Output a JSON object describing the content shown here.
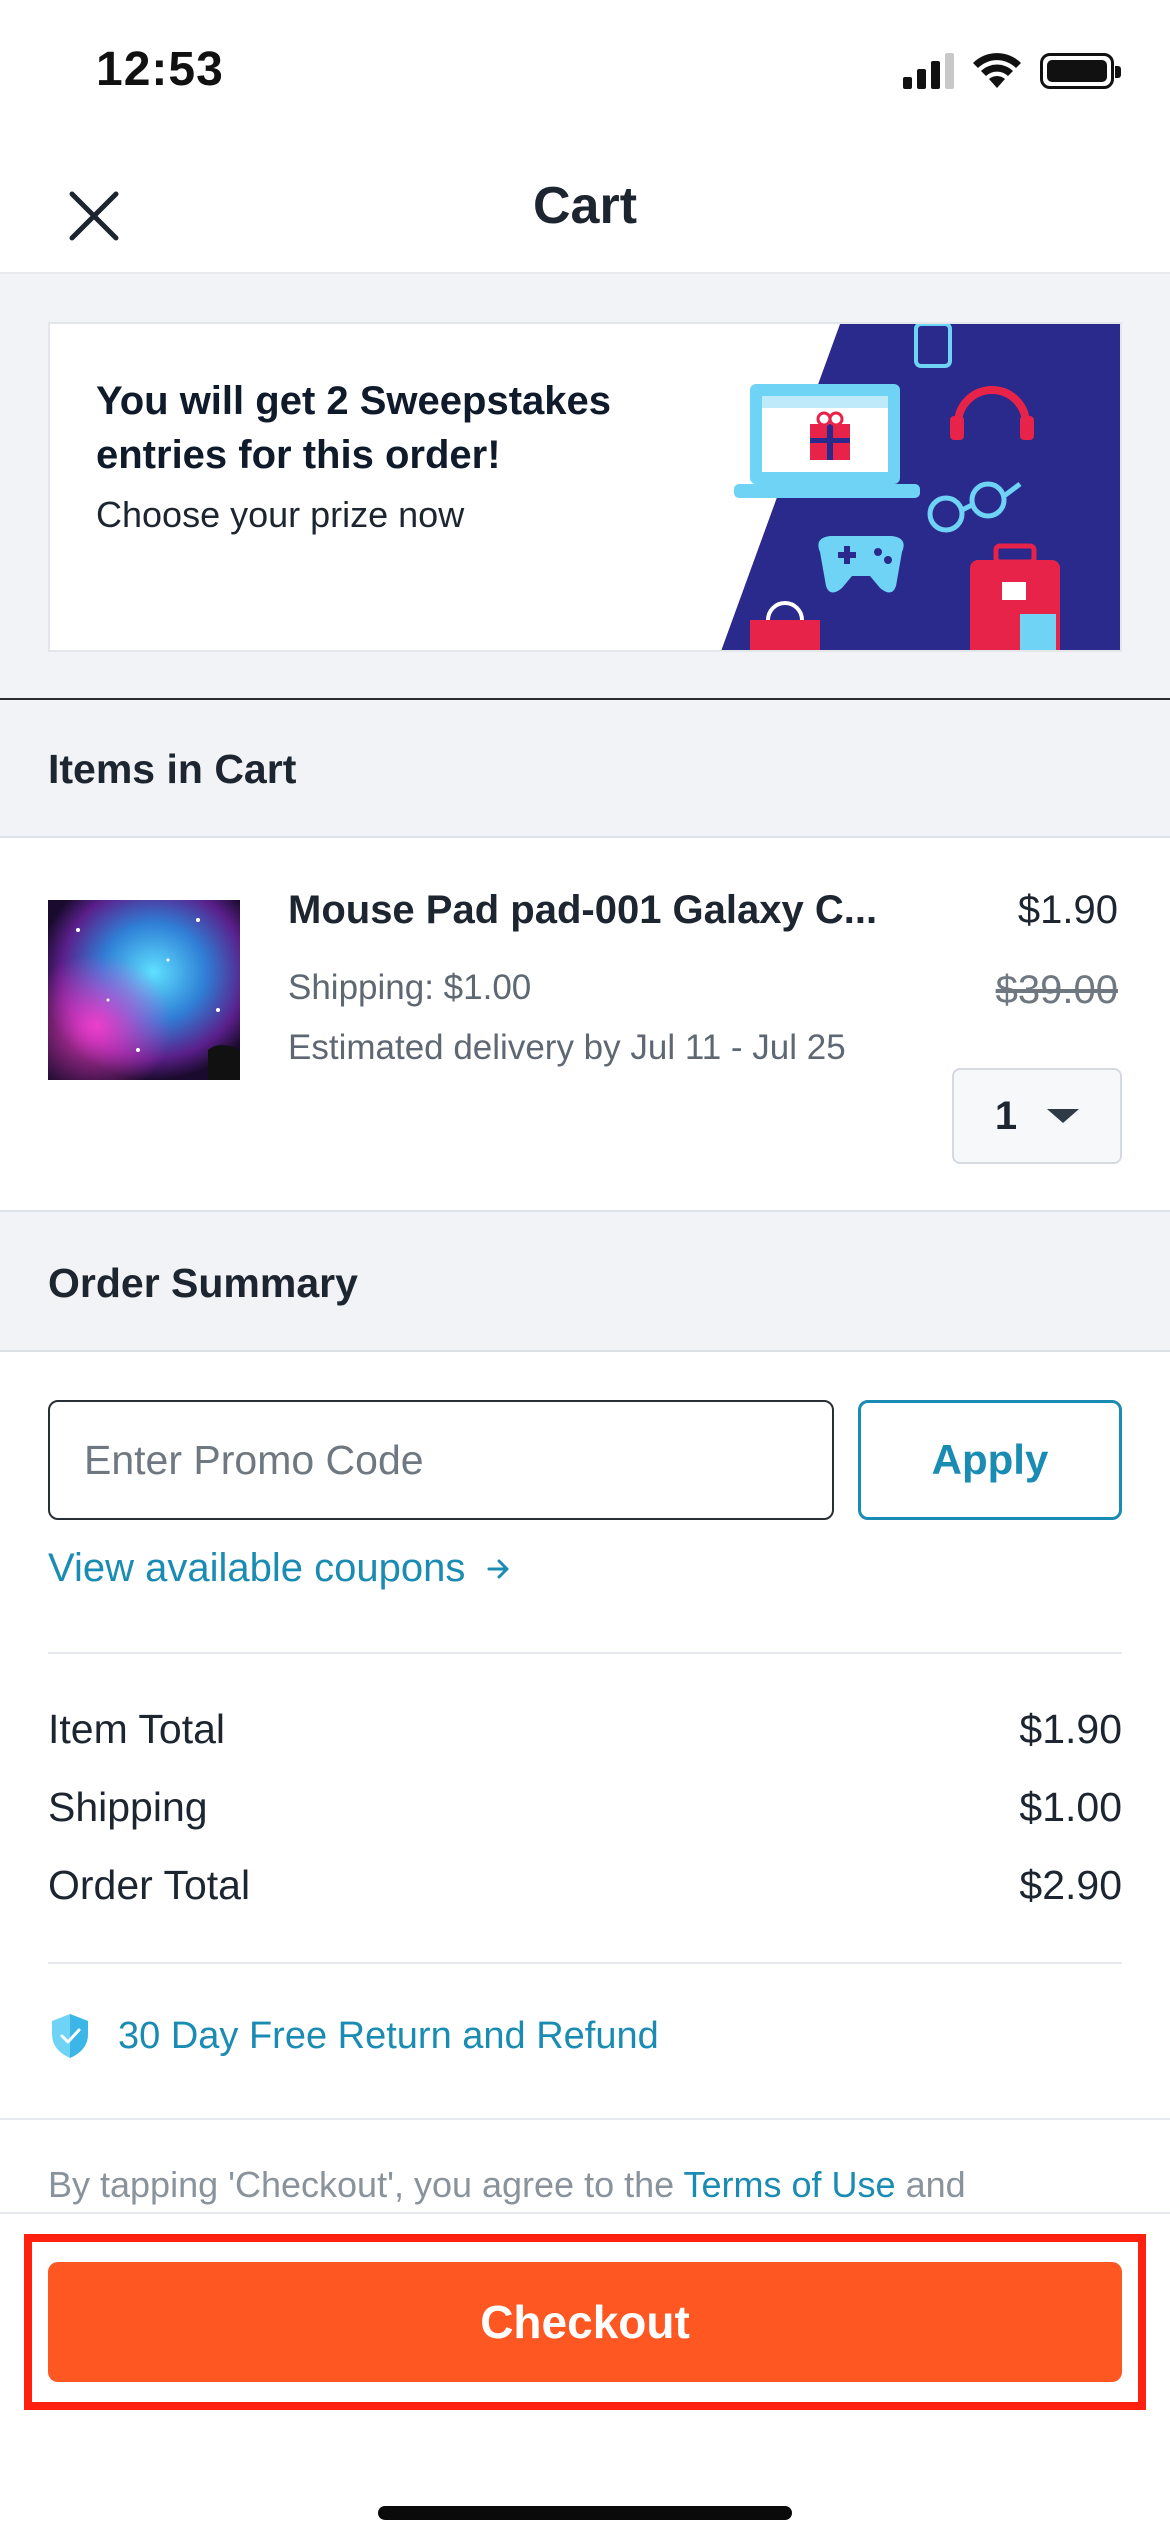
{
  "status_bar": {
    "time": "12:53"
  },
  "header": {
    "title": "Cart"
  },
  "sweepstakes_banner": {
    "title": "You will get 2 Sweepstakes entries for this order!",
    "subtitle": "Choose your prize now"
  },
  "cart_section": {
    "heading": "Items in Cart",
    "items": [
      {
        "name": "Mouse Pad pad-001 Galaxy C...",
        "shipping": "Shipping:  $1.00",
        "delivery": "Estimated delivery by Jul 11 - Jul 25",
        "price": "$1.90",
        "original_price": "$39.00",
        "quantity": "1"
      }
    ]
  },
  "order_summary": {
    "heading": "Order Summary",
    "promo_placeholder": "Enter Promo Code",
    "apply_label": "Apply",
    "coupons_link": "View available coupons",
    "rows": [
      {
        "label": "Item Total",
        "value": "$1.90"
      },
      {
        "label": "Shipping",
        "value": "$1.00"
      },
      {
        "label": "Order Total",
        "value": "$2.90"
      }
    ],
    "guarantee": "30 Day Free Return and Refund",
    "terms_prefix": "By tapping 'Checkout', you agree to the ",
    "terms_link": "Terms of Use",
    "terms_suffix": " and"
  },
  "footer": {
    "checkout_label": "Checkout"
  },
  "colors": {
    "accent": "#1a8cb3",
    "checkout": "#ff5722",
    "highlight": "#ff2010",
    "section_bg": "#f1f3f6"
  },
  "icons": [
    "close-icon",
    "shield-icon",
    "arrow-right-icon",
    "chevron-down-icon",
    "signal-icon",
    "wifi-icon",
    "battery-icon"
  ]
}
